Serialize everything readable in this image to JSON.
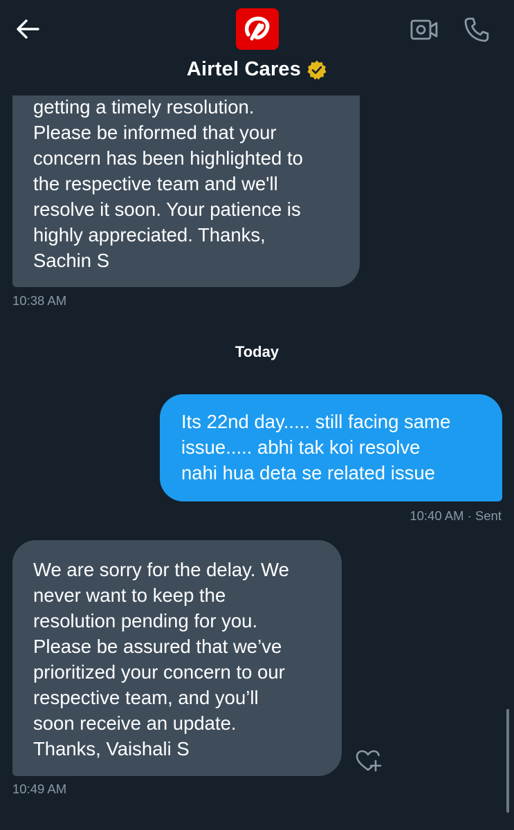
{
  "header": {
    "title": "Airtel Cares",
    "back_icon": "arrow-left-icon",
    "logo_icon": "airtel-logo-icon",
    "verified_icon": "verified-badge-icon",
    "video_icon": "video-call-icon",
    "call_icon": "phone-call-icon"
  },
  "messages": [
    {
      "direction": "received",
      "lines": [
        "getting a timely resolution.",
        "Please be informed that your",
        "concern has been highlighted to",
        "the respective team and we'll",
        "resolve it soon. Your patience is",
        "highly appreciated. Thanks,",
        "Sachin S"
      ],
      "time": "10:38 AM"
    },
    {
      "direction": "sent",
      "lines": [
        "Its 22nd day..... still facing same",
        "issue..... abhi tak koi resolve",
        "nahi hua deta se related issue"
      ],
      "time": "10:40 AM · Sent"
    },
    {
      "direction": "received",
      "lines": [
        "We are sorry for the delay. We",
        "never want to keep the",
        "resolution pending for you.",
        "Please be assured that we’ve",
        "prioritized your concern to our",
        "respective team, and you’ll",
        "soon receive an update.",
        "Thanks, Vaishali S"
      ],
      "time": "10:49 AM"
    }
  ],
  "date_separator": "Today",
  "react_icon": "heart-plus-icon",
  "colors": {
    "background": "#15202b",
    "received_bubble": "#3f4d5b",
    "sent_bubble": "#1d9bf0",
    "muted_text": "#8b98a5",
    "brand_red": "#e40000",
    "verified_gold": "#e2b719"
  }
}
